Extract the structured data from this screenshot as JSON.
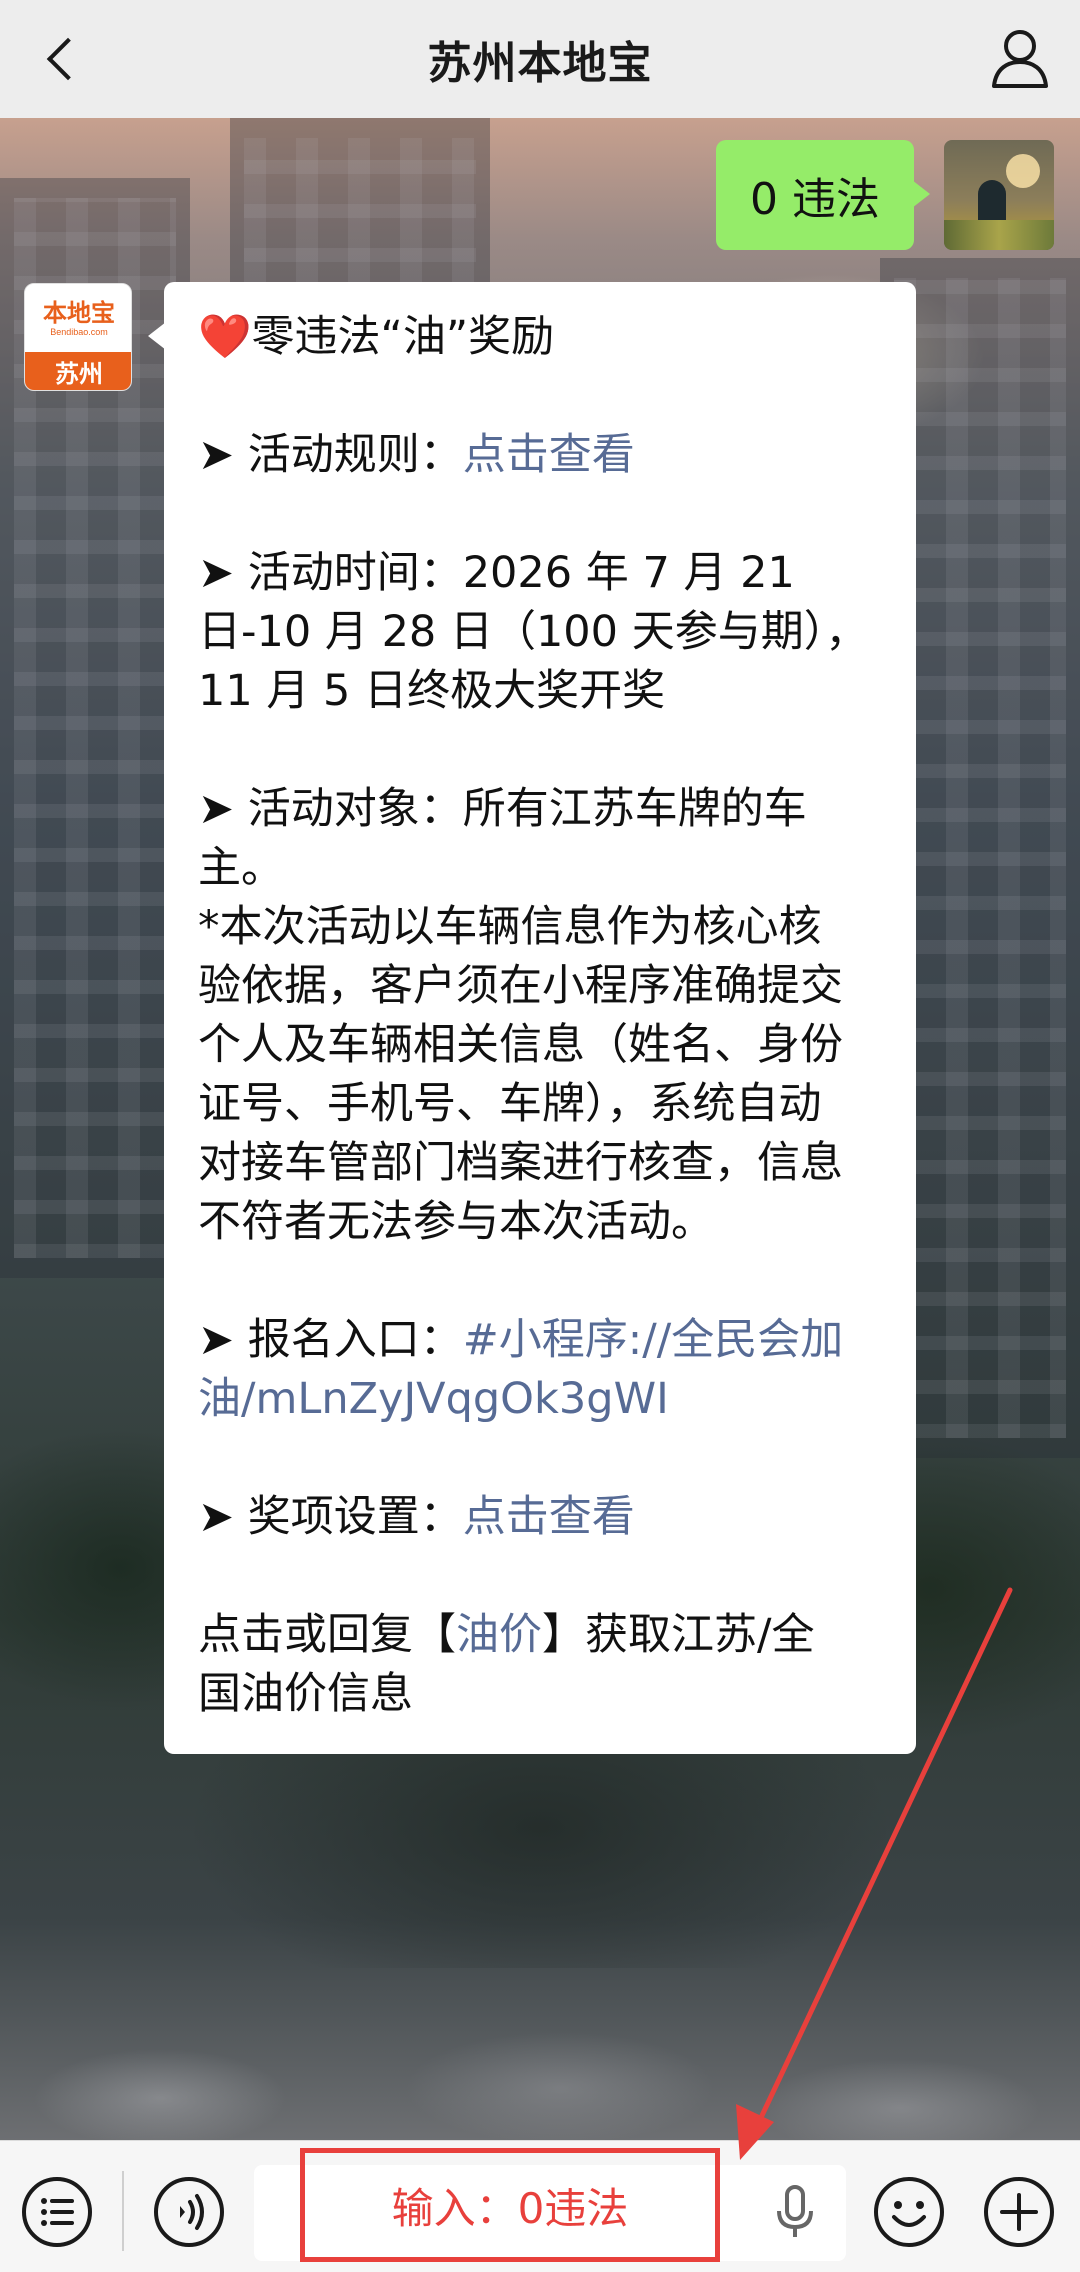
{
  "header": {
    "title": "苏州本地宝",
    "back_icon": "chevron-left-icon",
    "profile_icon": "person-icon"
  },
  "chat": {
    "sent_message": "0 违法",
    "sender_avatar": {
      "logo_cn": "本地宝",
      "logo_en": "Bendibao.com",
      "city": "苏州"
    },
    "reply": {
      "title_heart": "❤️",
      "title": "零违法“油”奖励",
      "rules_label": "➤ 活动规则：",
      "rules_link": "点击查看",
      "time_line1": "➤ 活动时间：2026 年 7 月 21",
      "time_line2": "日-10 月 28 日（100 天参与期），",
      "time_line3": "11 月 5 日终极大奖开奖",
      "target_line1": "➤ 活动对象：所有江苏车牌的车",
      "target_line2": "主。",
      "note_lines": [
        "*本次活动以车辆信息作为核心核",
        "验依据，客户须在小程序准确提交",
        "个人及车辆相关信息（姓名、身份",
        "证号、手机号、车牌），系统自动",
        "对接车管部门档案进行核查，信息",
        "不符者无法参与本次活动。"
      ],
      "entry_label": "➤ 报名入口：",
      "entry_link_line1": "#小程序://全民会加",
      "entry_link_line2": "油/mLnZyJVqgOk3gWI",
      "prize_label": "➤ 奖项设置：",
      "prize_link": "点击查看",
      "footer_pre": "点击或回复【",
      "footer_link": "油价",
      "footer_post": "】获取江苏/全",
      "footer_line2": "国油价信息"
    }
  },
  "input_bar": {
    "menu_icon": "list-menu-icon",
    "voice_icon": "voice-mode-icon",
    "mic_icon": "microphone-icon",
    "emoji_icon": "emoji-icon",
    "plus_icon": "plus-icon",
    "annotation_text": "输入：0违法"
  },
  "colors": {
    "sent_bubble": "#95ec69",
    "link": "#576b95",
    "annotation": "#e8403c",
    "brand": "#e8601c"
  }
}
